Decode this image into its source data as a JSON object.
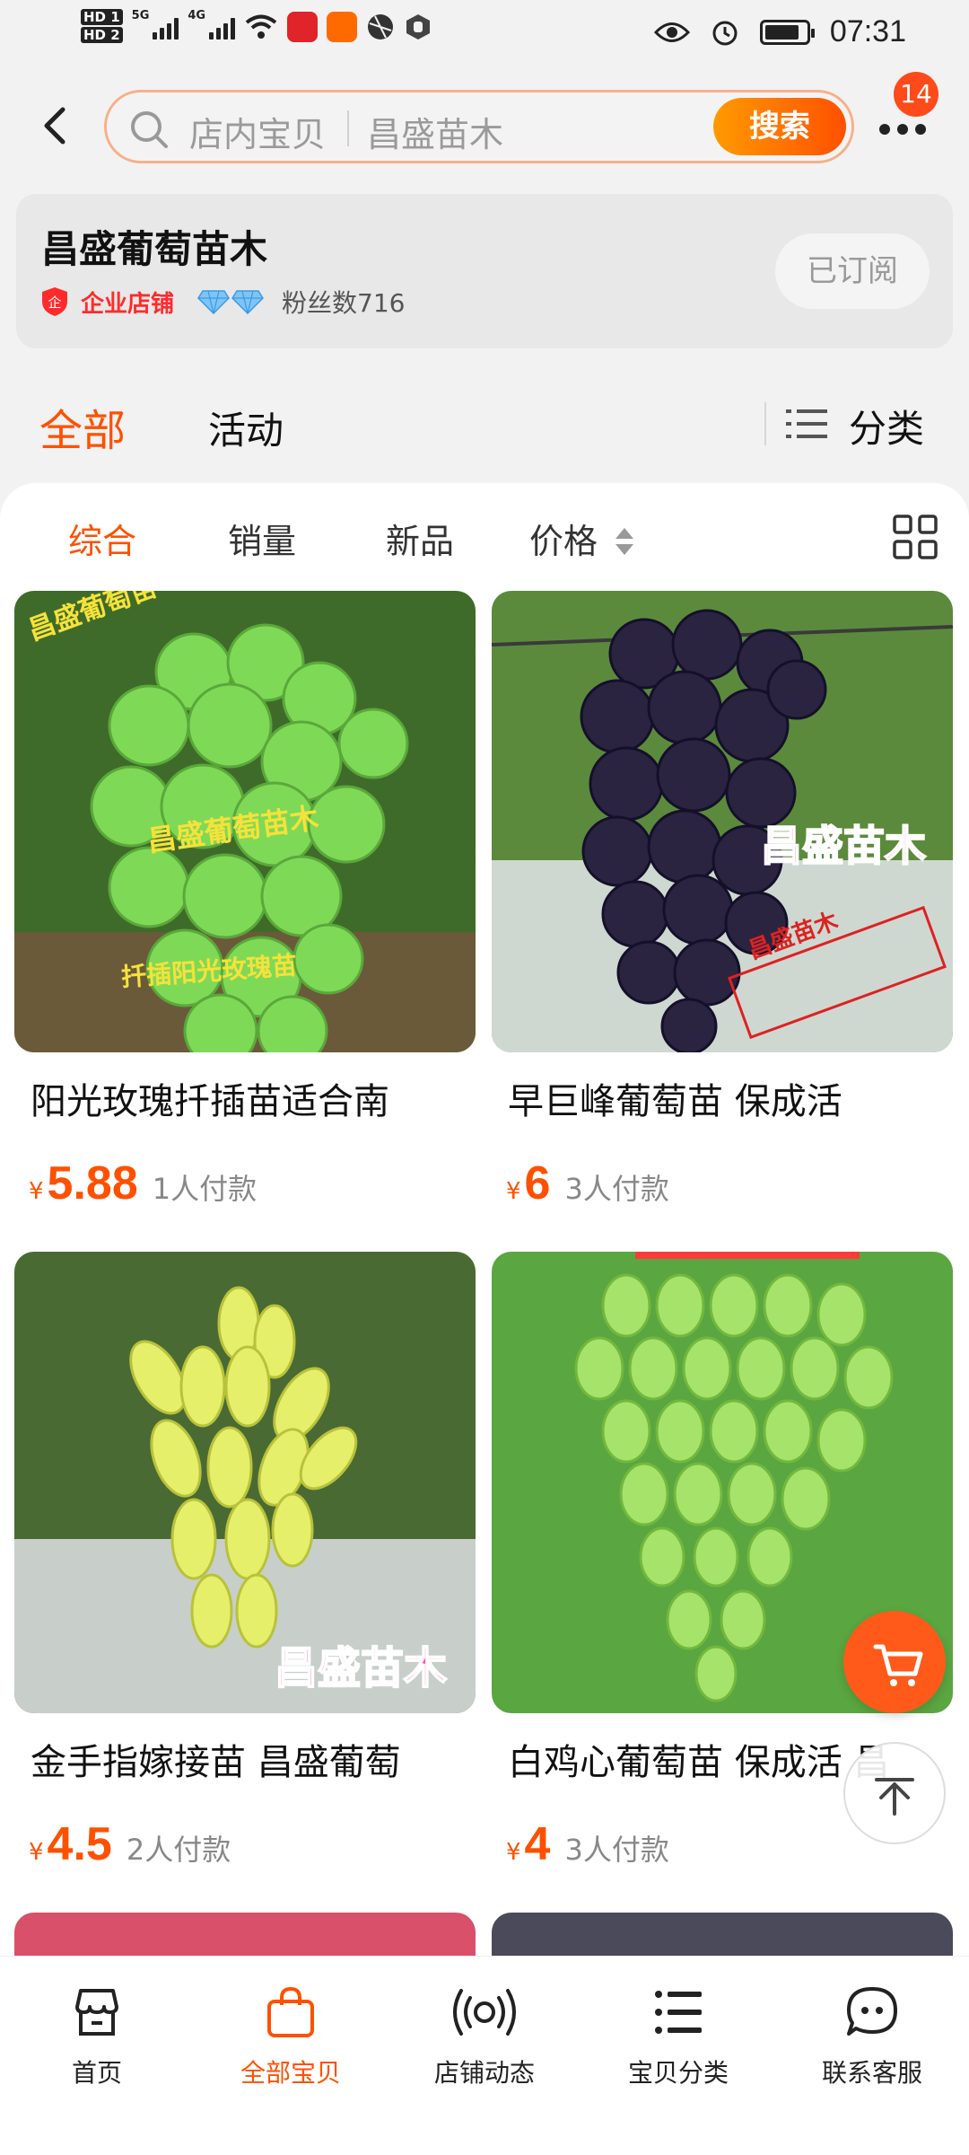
{
  "status_bar": {
    "net_labels": [
      "HD 1",
      "HD 2"
    ],
    "signal_labels": [
      "5G",
      "4G"
    ],
    "time": "07:31"
  },
  "header": {
    "search_placeholder": "店内宝贝",
    "shop_scope": "昌盛苗木",
    "search_button": "搜索",
    "notification_count": "14"
  },
  "shop": {
    "name": "昌盛葡萄苗木",
    "badge": "企业店铺",
    "fans": "粉丝数716",
    "subscribe": "已订阅"
  },
  "tabs": {
    "all": "全部",
    "activity": "活动",
    "category": "分类"
  },
  "sort": [
    "综合",
    "销量",
    "新品",
    "价格"
  ],
  "products": [
    {
      "title": "阳光玫瑰扦插苗适合南",
      "price": "5.88",
      "sold": "1人付款",
      "overlay": [
        "昌盛葡萄苗",
        "昌盛葡萄苗木",
        "扦插阳光玫瑰苗"
      ]
    },
    {
      "title": "早巨峰葡萄苗  保成活",
      "price": "6",
      "sold": "3人付款",
      "overlay": [
        "昌盛苗木",
        "昌盛苗木"
      ]
    },
    {
      "title": "金手指嫁接苗 昌盛葡萄",
      "price": "4.5",
      "sold": "2人付款",
      "overlay": [
        "昌盛苗木"
      ]
    },
    {
      "title": "白鸡心葡萄苗 保成活 昌",
      "price": "4",
      "sold": "3人付款",
      "overlay": []
    }
  ],
  "currency": "¥",
  "bottom_nav": [
    "首页",
    "全部宝贝",
    "店铺动态",
    "宝贝分类",
    "联系客服"
  ],
  "colors": {
    "accent": "#ff5000",
    "badge": "#ff4a1a"
  }
}
